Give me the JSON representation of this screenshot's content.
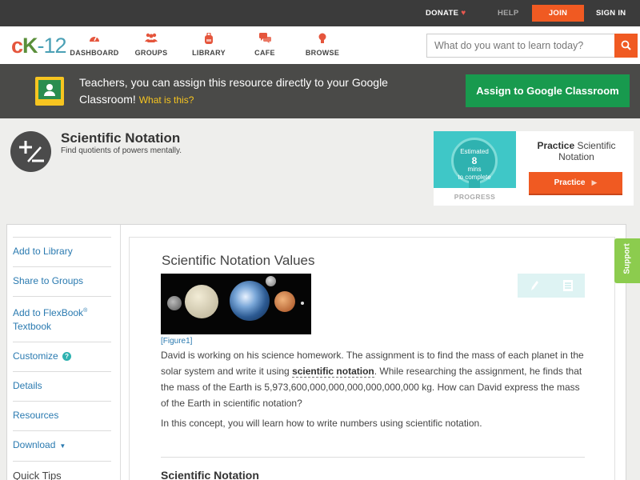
{
  "topbar": {
    "donate": "DONATE",
    "help": "HELP",
    "join": "JOIN",
    "signin": "SIGN IN"
  },
  "brand": {
    "logo_c": "c",
    "logo_k": "K",
    "logo_rest": "-12",
    "accent": "#f05a22",
    "link": "#2a7ab0"
  },
  "nav": {
    "dashboard": "DASHBOARD",
    "groups": "GROUPS",
    "library": "LIBRARY",
    "cafe": "CAFE",
    "browse": "BROWSE"
  },
  "search": {
    "placeholder": "What do you want to learn today?"
  },
  "classroom": {
    "text": "Teachers, you can assign this resource directly to your Google Classroom!",
    "what": "What is this?",
    "button": "Assign to Google Classroom"
  },
  "concept": {
    "title": "Scientific Notation",
    "subtitle": "Find quotients of powers mentally."
  },
  "practice": {
    "estimated": "Estimated",
    "mins": "8",
    "mins_label": "mins",
    "to_complete": "to complete",
    "progress_label": "PROGRESS",
    "title_bold": "Practice",
    "title_rest": "Scientific Notation",
    "button": "Practice"
  },
  "sidebar": {
    "items": [
      {
        "label": "Add to Library"
      },
      {
        "label": "Share to Groups"
      },
      {
        "label": "Add to FlexBook",
        "sup": "®",
        "label2": "Textbook"
      },
      {
        "label": "Customize"
      },
      {
        "label": "Details"
      },
      {
        "label": "Resources"
      },
      {
        "label": "Download"
      }
    ],
    "tips": "Quick Tips"
  },
  "article": {
    "title": "Scientific Notation Values",
    "caption": "[Figure1]",
    "p1_a": "David is working on his science homework. The assignment is to find the mass of each planet in the solar system and write it using ",
    "p1_term": "scientific notation",
    "p1_b": ". While researching the assignment, he finds that the mass of the Earth is 5,973,600,000,000,000,000,000,000 kg. How can David express the mass of the Earth in scientific notation?",
    "p2": "In this concept, you will learn how to write numbers using scientific notation.",
    "h2": "Scientific Notation"
  },
  "support": "Support"
}
